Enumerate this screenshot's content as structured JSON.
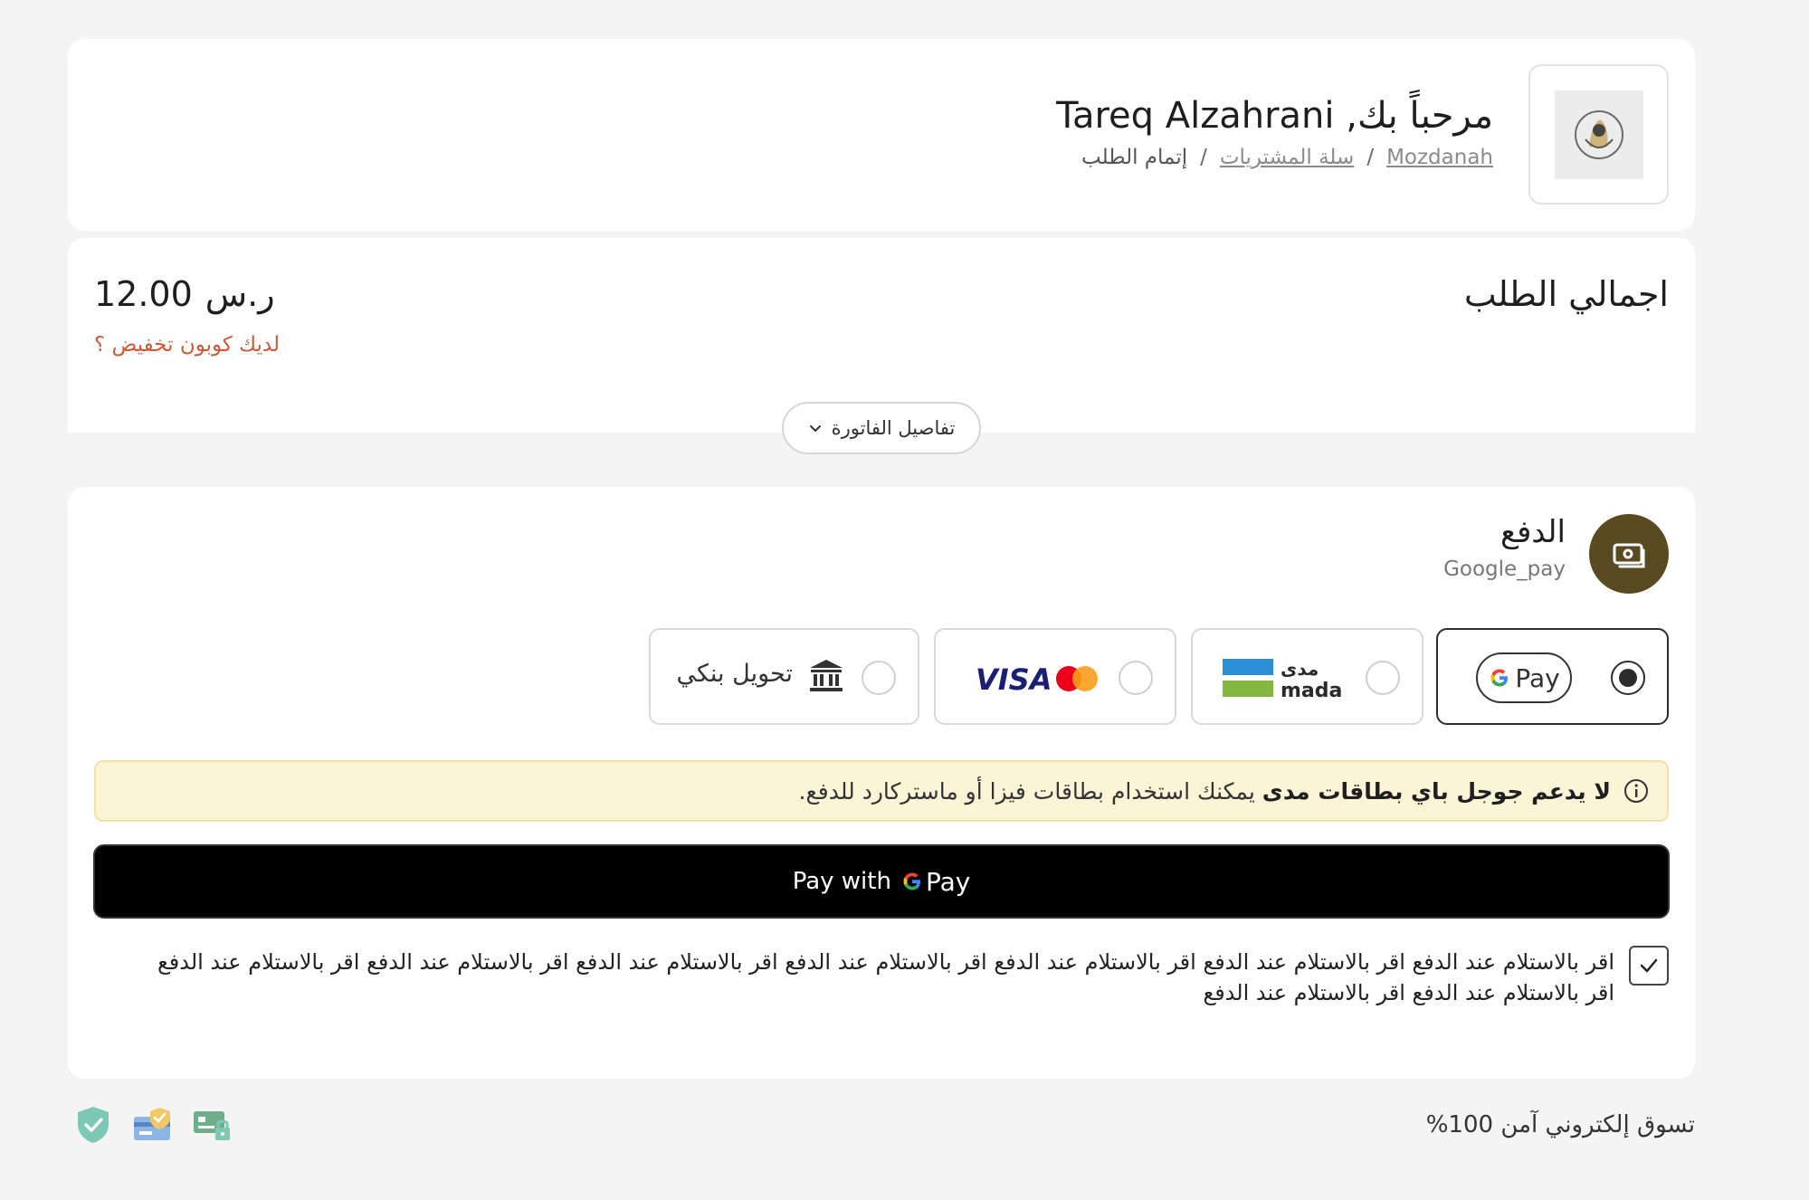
{
  "header": {
    "welcome": "مرحباً بك, Tareq Alzahrani",
    "breadcrumb": {
      "store": "Mozdanah",
      "cart": "سلة المشتريات",
      "current": "إتمام الطلب",
      "separator": "/"
    },
    "logo_icon": "store-logo"
  },
  "order_total": {
    "title": "اجمالي الطلب",
    "amount": "12.00",
    "currency": "ر.س",
    "coupon_link": "لديك كوبون تخفيض ؟",
    "invoice_toggle": "تفاصيل الفاتورة"
  },
  "payment": {
    "title": "الدفع",
    "subtitle": "Google_pay",
    "icon": "money-icon",
    "methods": [
      {
        "id": "gpay",
        "label": "Pay",
        "selected": true
      },
      {
        "id": "mada",
        "label_ar": "مدى",
        "label_en": "mada",
        "selected": false
      },
      {
        "id": "visa",
        "label": "VISA",
        "selected": false
      },
      {
        "id": "bank",
        "label": "تحويل بنكي",
        "selected": false
      }
    ],
    "notice_bold": "لا يدعم جوجل باي بطاقات مدى",
    "notice_rest": "يمكنك استخدام بطاقات فيزا أو ماستركارد للدفع.",
    "pay_button_prefix": "Pay with",
    "pay_button_brand": "Pay",
    "terms": "اقر بالاستلام عند الدفع اقر بالاستلام عند الدفع اقر بالاستلام عند الدفع اقر بالاستلام عند الدفع اقر بالاستلام عند الدفع اقر بالاستلام عند الدفع اقر بالاستلام عند الدفع اقر بالاستلام عند الدفع اقر بالاستلام عند الدفع",
    "terms_checked": true
  },
  "footer": {
    "secure_text": "تسوق إلكتروني آمن 100%",
    "trust_icons": [
      "shield-check-icon",
      "card-verified-icon",
      "card-lock-icon"
    ]
  },
  "colors": {
    "accent_brown": "#5a4a22",
    "coupon_red": "#c85a3d",
    "notice_bg": "#fcf4d6"
  }
}
